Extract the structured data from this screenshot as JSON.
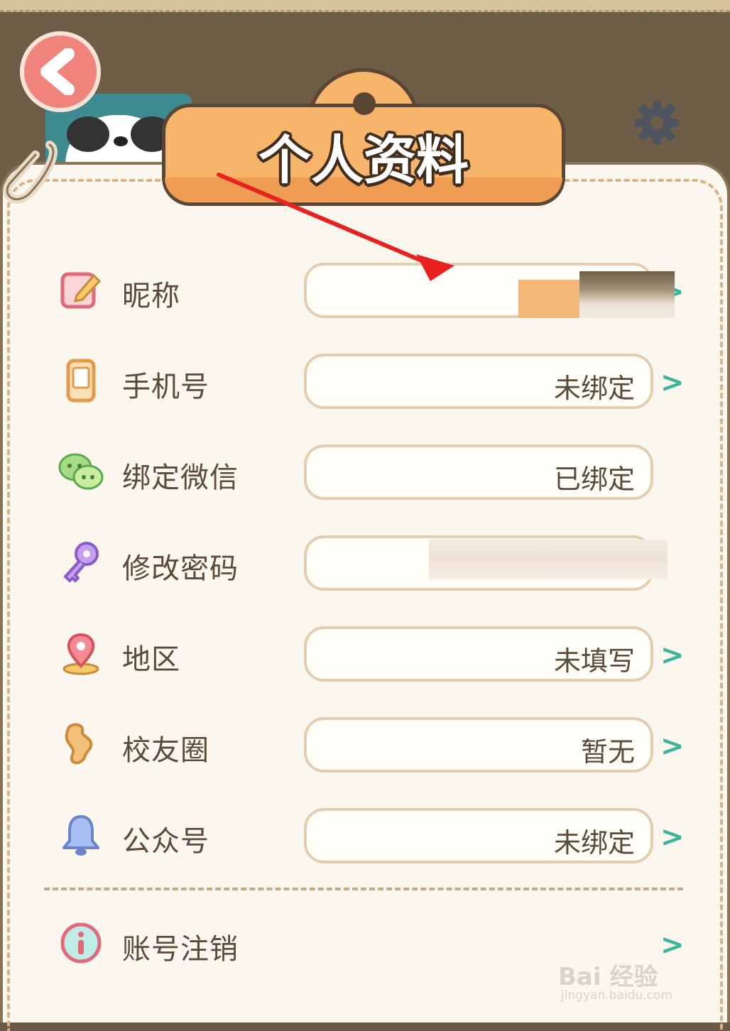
{
  "header": {
    "title": "个人资料"
  },
  "rows": [
    {
      "label": "昵称",
      "value": "",
      "has_arrow": true
    },
    {
      "label": "手机号",
      "value": "未绑定",
      "has_arrow": true
    },
    {
      "label": "绑定微信",
      "value": "已绑定",
      "has_arrow": false
    },
    {
      "label": "修改密码",
      "value": "",
      "has_arrow": false
    },
    {
      "label": "地区",
      "value": "未填写",
      "has_arrow": true
    },
    {
      "label": "校友圈",
      "value": "暂无",
      "has_arrow": true
    },
    {
      "label": "公众号",
      "value": "未绑定",
      "has_arrow": true
    }
  ],
  "account": {
    "label": "账号注销"
  },
  "arrow_glyph": ">",
  "icons": [
    "back-icon",
    "settings-gear-icon",
    "edit-icon",
    "phone-icon",
    "wechat-icon",
    "key-icon",
    "location-pin-icon",
    "bone-icon",
    "bell-icon",
    "info-icon"
  ],
  "colors": {
    "accent_orange": "#f7b46b",
    "arrow_green": "#3cb39a",
    "back_button_red": "#f0837c",
    "panel_bg": "#fbf7ee",
    "annotation_red": "#e8231f"
  },
  "watermark": {
    "brand": "Bai 经验",
    "url": "jingyan.baidu.com"
  }
}
